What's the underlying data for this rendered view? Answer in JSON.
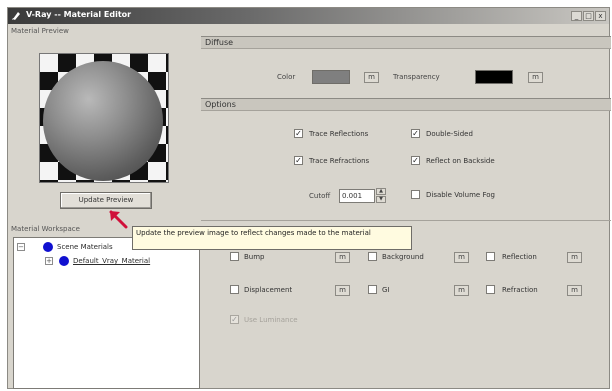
{
  "window": {
    "title": "V-Ray -- Material Editor",
    "controls": [
      "minimize-icon",
      "restore-icon",
      "close-icon"
    ]
  },
  "preview": {
    "label": "Material Preview",
    "update_button": "Update Preview",
    "tooltip": "Update the preview image to reflect changes made to the material"
  },
  "workspace": {
    "label": "Material Workspace",
    "items": [
      {
        "label": "Scene Materials",
        "expander": "−"
      },
      {
        "label": "Default_Vray_Material",
        "expander": "+"
      }
    ]
  },
  "diffuse": {
    "header": "Diffuse",
    "color_label": "Color",
    "color_value": "#7f7f7f",
    "transparency_label": "Transparency",
    "transparency_value": "#000000",
    "map_button": "m"
  },
  "options": {
    "header": "Options",
    "checkboxes": [
      {
        "label": "Trace Reflections",
        "checked": true
      },
      {
        "label": "Double-Sided",
        "checked": true
      },
      {
        "label": "Trace Refractions",
        "checked": true
      },
      {
        "label": "Reflect on Backside",
        "checked": true
      },
      {
        "label": "Disable Volume Fog",
        "checked": false
      }
    ],
    "cutoff_label": "Cutoff",
    "cutoff_value": "0.001"
  },
  "maps": {
    "map_button": "m",
    "items": [
      {
        "label": "Bump",
        "checked": false
      },
      {
        "label": "Background",
        "checked": false
      },
      {
        "label": "Reflection",
        "checked": false
      },
      {
        "label": "Displacement",
        "checked": false
      },
      {
        "label": "GI",
        "checked": false
      },
      {
        "label": "Refraction",
        "checked": false
      }
    ],
    "disabled_item": {
      "label": "Use Luminance",
      "checked": true
    }
  },
  "colors": {
    "title_bar_dark": "#3a3a3a",
    "tree_dot": "#1010d0",
    "arrow": "#d0103a",
    "tooltip_bg": "#fffbe0"
  }
}
